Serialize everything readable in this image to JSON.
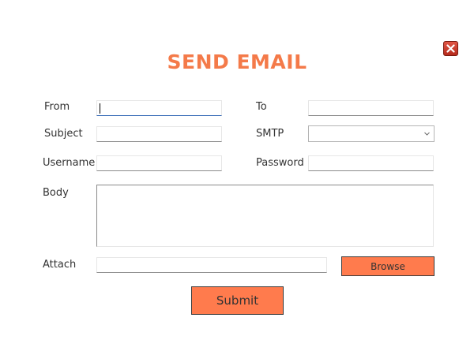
{
  "window": {
    "title": "SEND EMAIL",
    "close_icon": "close-icon"
  },
  "form": {
    "from": {
      "label": "From",
      "value": ""
    },
    "to": {
      "label": "To",
      "value": ""
    },
    "subject": {
      "label": "Subject",
      "value": ""
    },
    "smtp": {
      "label": "SMTP",
      "value": ""
    },
    "username": {
      "label": "Username",
      "value": ""
    },
    "password": {
      "label": "Password",
      "value": ""
    },
    "body": {
      "label": "Body",
      "value": ""
    },
    "attach": {
      "label": "Attach",
      "value": ""
    }
  },
  "buttons": {
    "browse": "Browse",
    "submit": "Submit"
  },
  "colors": {
    "accent": "#f47a49",
    "button": "#ff7b4d",
    "close": "#c9392b"
  }
}
